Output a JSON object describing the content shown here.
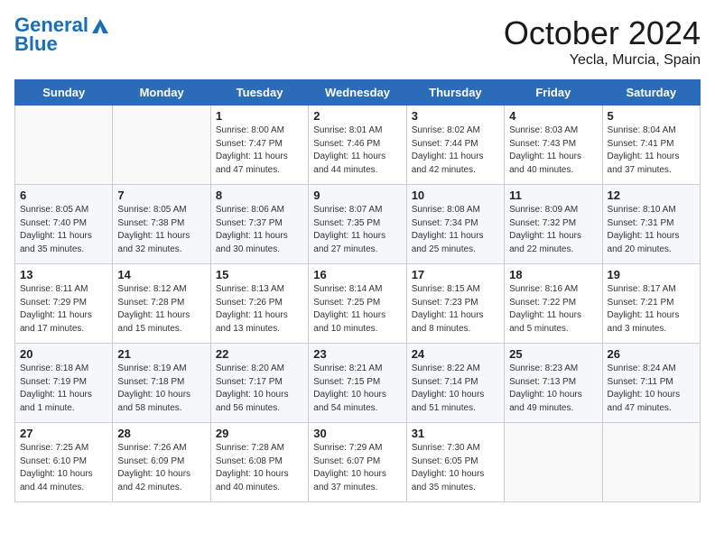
{
  "header": {
    "logo_line1": "General",
    "logo_line2": "Blue",
    "month": "October 2024",
    "location": "Yecla, Murcia, Spain"
  },
  "weekdays": [
    "Sunday",
    "Monday",
    "Tuesday",
    "Wednesday",
    "Thursday",
    "Friday",
    "Saturday"
  ],
  "weeks": [
    [
      {
        "day": "",
        "empty": true
      },
      {
        "day": "",
        "empty": true
      },
      {
        "day": "1",
        "sunrise": "Sunrise: 8:00 AM",
        "sunset": "Sunset: 7:47 PM",
        "daylight": "Daylight: 11 hours and 47 minutes."
      },
      {
        "day": "2",
        "sunrise": "Sunrise: 8:01 AM",
        "sunset": "Sunset: 7:46 PM",
        "daylight": "Daylight: 11 hours and 44 minutes."
      },
      {
        "day": "3",
        "sunrise": "Sunrise: 8:02 AM",
        "sunset": "Sunset: 7:44 PM",
        "daylight": "Daylight: 11 hours and 42 minutes."
      },
      {
        "day": "4",
        "sunrise": "Sunrise: 8:03 AM",
        "sunset": "Sunset: 7:43 PM",
        "daylight": "Daylight: 11 hours and 40 minutes."
      },
      {
        "day": "5",
        "sunrise": "Sunrise: 8:04 AM",
        "sunset": "Sunset: 7:41 PM",
        "daylight": "Daylight: 11 hours and 37 minutes."
      }
    ],
    [
      {
        "day": "6",
        "sunrise": "Sunrise: 8:05 AM",
        "sunset": "Sunset: 7:40 PM",
        "daylight": "Daylight: 11 hours and 35 minutes."
      },
      {
        "day": "7",
        "sunrise": "Sunrise: 8:05 AM",
        "sunset": "Sunset: 7:38 PM",
        "daylight": "Daylight: 11 hours and 32 minutes."
      },
      {
        "day": "8",
        "sunrise": "Sunrise: 8:06 AM",
        "sunset": "Sunset: 7:37 PM",
        "daylight": "Daylight: 11 hours and 30 minutes."
      },
      {
        "day": "9",
        "sunrise": "Sunrise: 8:07 AM",
        "sunset": "Sunset: 7:35 PM",
        "daylight": "Daylight: 11 hours and 27 minutes."
      },
      {
        "day": "10",
        "sunrise": "Sunrise: 8:08 AM",
        "sunset": "Sunset: 7:34 PM",
        "daylight": "Daylight: 11 hours and 25 minutes."
      },
      {
        "day": "11",
        "sunrise": "Sunrise: 8:09 AM",
        "sunset": "Sunset: 7:32 PM",
        "daylight": "Daylight: 11 hours and 22 minutes."
      },
      {
        "day": "12",
        "sunrise": "Sunrise: 8:10 AM",
        "sunset": "Sunset: 7:31 PM",
        "daylight": "Daylight: 11 hours and 20 minutes."
      }
    ],
    [
      {
        "day": "13",
        "sunrise": "Sunrise: 8:11 AM",
        "sunset": "Sunset: 7:29 PM",
        "daylight": "Daylight: 11 hours and 17 minutes."
      },
      {
        "day": "14",
        "sunrise": "Sunrise: 8:12 AM",
        "sunset": "Sunset: 7:28 PM",
        "daylight": "Daylight: 11 hours and 15 minutes."
      },
      {
        "day": "15",
        "sunrise": "Sunrise: 8:13 AM",
        "sunset": "Sunset: 7:26 PM",
        "daylight": "Daylight: 11 hours and 13 minutes."
      },
      {
        "day": "16",
        "sunrise": "Sunrise: 8:14 AM",
        "sunset": "Sunset: 7:25 PM",
        "daylight": "Daylight: 11 hours and 10 minutes."
      },
      {
        "day": "17",
        "sunrise": "Sunrise: 8:15 AM",
        "sunset": "Sunset: 7:23 PM",
        "daylight": "Daylight: 11 hours and 8 minutes."
      },
      {
        "day": "18",
        "sunrise": "Sunrise: 8:16 AM",
        "sunset": "Sunset: 7:22 PM",
        "daylight": "Daylight: 11 hours and 5 minutes."
      },
      {
        "day": "19",
        "sunrise": "Sunrise: 8:17 AM",
        "sunset": "Sunset: 7:21 PM",
        "daylight": "Daylight: 11 hours and 3 minutes."
      }
    ],
    [
      {
        "day": "20",
        "sunrise": "Sunrise: 8:18 AM",
        "sunset": "Sunset: 7:19 PM",
        "daylight": "Daylight: 11 hours and 1 minute."
      },
      {
        "day": "21",
        "sunrise": "Sunrise: 8:19 AM",
        "sunset": "Sunset: 7:18 PM",
        "daylight": "Daylight: 10 hours and 58 minutes."
      },
      {
        "day": "22",
        "sunrise": "Sunrise: 8:20 AM",
        "sunset": "Sunset: 7:17 PM",
        "daylight": "Daylight: 10 hours and 56 minutes."
      },
      {
        "day": "23",
        "sunrise": "Sunrise: 8:21 AM",
        "sunset": "Sunset: 7:15 PM",
        "daylight": "Daylight: 10 hours and 54 minutes."
      },
      {
        "day": "24",
        "sunrise": "Sunrise: 8:22 AM",
        "sunset": "Sunset: 7:14 PM",
        "daylight": "Daylight: 10 hours and 51 minutes."
      },
      {
        "day": "25",
        "sunrise": "Sunrise: 8:23 AM",
        "sunset": "Sunset: 7:13 PM",
        "daylight": "Daylight: 10 hours and 49 minutes."
      },
      {
        "day": "26",
        "sunrise": "Sunrise: 8:24 AM",
        "sunset": "Sunset: 7:11 PM",
        "daylight": "Daylight: 10 hours and 47 minutes."
      }
    ],
    [
      {
        "day": "27",
        "sunrise": "Sunrise: 7:25 AM",
        "sunset": "Sunset: 6:10 PM",
        "daylight": "Daylight: 10 hours and 44 minutes."
      },
      {
        "day": "28",
        "sunrise": "Sunrise: 7:26 AM",
        "sunset": "Sunset: 6:09 PM",
        "daylight": "Daylight: 10 hours and 42 minutes."
      },
      {
        "day": "29",
        "sunrise": "Sunrise: 7:28 AM",
        "sunset": "Sunset: 6:08 PM",
        "daylight": "Daylight: 10 hours and 40 minutes."
      },
      {
        "day": "30",
        "sunrise": "Sunrise: 7:29 AM",
        "sunset": "Sunset: 6:07 PM",
        "daylight": "Daylight: 10 hours and 37 minutes."
      },
      {
        "day": "31",
        "sunrise": "Sunrise: 7:30 AM",
        "sunset": "Sunset: 6:05 PM",
        "daylight": "Daylight: 10 hours and 35 minutes."
      },
      {
        "day": "",
        "empty": true
      },
      {
        "day": "",
        "empty": true
      }
    ]
  ]
}
